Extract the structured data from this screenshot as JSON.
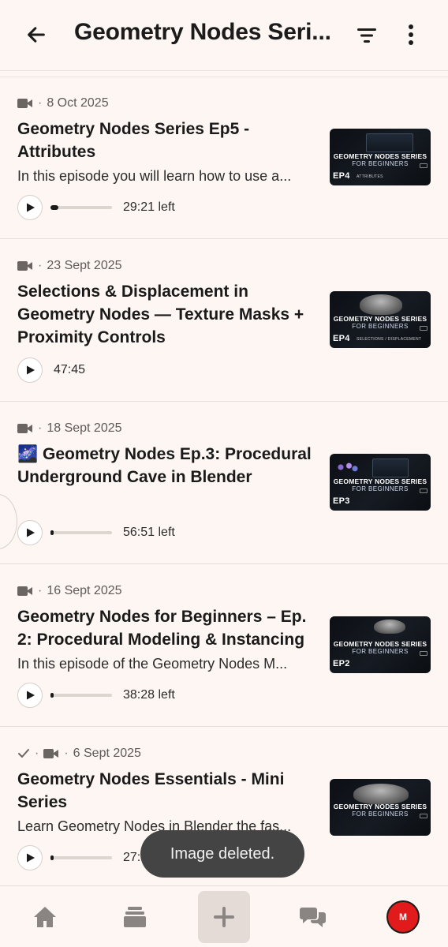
{
  "header": {
    "title": "Geometry Nodes Seri...",
    "back_icon": "arrow-left-icon",
    "filter_icon": "filter-icon",
    "more_icon": "more-vertical-icon"
  },
  "episodes": [
    {
      "date": "8 Oct 2025",
      "title": "Geometry Nodes Series Ep5 - Attributes",
      "description": "In this episode you will learn how to use a...",
      "time": "29:21 left",
      "progress": 0.13,
      "watched": false,
      "thumb": {
        "badge": "EP4",
        "title": "GEOMETRY NODES SERIES",
        "subtitle": "FOR BEGINNERS",
        "caption": "ATTRIBUTES"
      }
    },
    {
      "date": "23 Sept 2025",
      "title": "Selections & Displacement in Geometry Nodes — Texture Masks + Proximity Controls",
      "description": "",
      "time": "47:45",
      "progress": null,
      "watched": false,
      "thumb": {
        "badge": "EP4",
        "title": "GEOMETRY NODES SERIES",
        "subtitle": "FOR BEGINNERS",
        "caption": "SELECTIONS / DISPLACEMENT"
      }
    },
    {
      "date": "18 Sept 2025",
      "title": "🌌 Geometry Nodes Ep.3: Procedural Underground Cave in Blender",
      "description": "",
      "time": "56:51 left",
      "progress": 0.03,
      "watched": false,
      "thumb": {
        "badge": "EP3",
        "title": "GEOMETRY NODES SERIES",
        "subtitle": "FOR BEGINNERS",
        "caption": ""
      }
    },
    {
      "date": "16 Sept 2025",
      "title": "Geometry Nodes for Beginners – Ep. 2: Procedural Modeling & Instancing",
      "description": "In this episode of the Geometry Nodes M...",
      "time": "38:28 left",
      "progress": 0.03,
      "watched": false,
      "thumb": {
        "badge": "EP2",
        "title": "GEOMETRY NODES SERIES",
        "subtitle": "FOR BEGINNERS",
        "caption": ""
      }
    },
    {
      "date": "6 Sept 2025",
      "title": "Geometry Nodes Essentials - Mini Series",
      "description": "Learn Geometry Nodes in Blender the fas...",
      "time": "27:49 left",
      "progress": 0.03,
      "watched": true,
      "thumb": {
        "badge": "",
        "title": "GEOMETRY NODES SERIES",
        "subtitle": "FOR BEGINNERS",
        "caption": ""
      }
    }
  ],
  "toast": {
    "text": "Image deleted."
  },
  "bottom_nav": {
    "avatar_initial": "M",
    "items": [
      "home-icon",
      "library-icon",
      "add-icon",
      "chat-icon",
      "avatar"
    ]
  },
  "colors": {
    "background": "#fdf6f2",
    "avatar": "#e11b1b",
    "toast": "#444444"
  }
}
